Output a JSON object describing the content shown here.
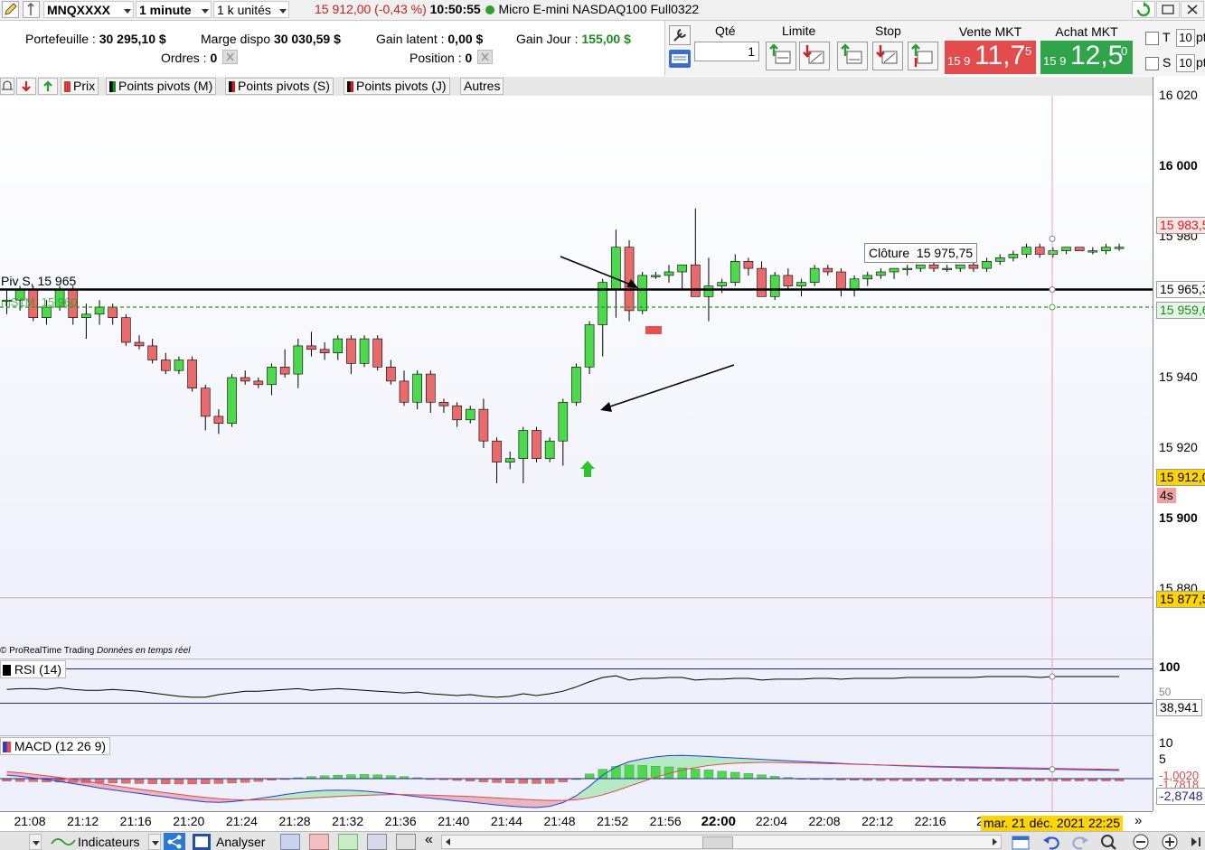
{
  "header": {
    "symbol": "MNQXXXX",
    "timeframe": "1 minute",
    "units": "1 k unités",
    "price_change": "15 912,00 (-0,43 %)",
    "time": "10:50:55",
    "instrument": "Micro E-mini NASDAQ100 Full0322",
    "status_color": "#28a428"
  },
  "account": {
    "portfolio_label": "Portefeuille :",
    "portfolio_value": "30 295,10 $",
    "margin_label": "Marge dispo",
    "margin_value": "30 030,59 $",
    "latent_label": "Gain latent :",
    "latent_value": "0,00 $",
    "day_gain_label": "Gain Jour :",
    "day_gain_value": "155,00 $",
    "orders_label": "Ordres :",
    "orders_value": "0",
    "position_label": "Position :",
    "position_value": "0"
  },
  "order_panel": {
    "qty_label": "Qté",
    "qty_value": "1",
    "limit_label": "Limite",
    "stop_label": "Stop",
    "sell_label": "Vente MKT",
    "sell_small": "15 9",
    "sell_big": "11,7",
    "sell_sup": "5",
    "buy_label": "Achat MKT",
    "buy_small": "15 9",
    "buy_big": "12,5",
    "buy_sup": "0",
    "t_label": "T",
    "s_label": "S",
    "t_value": "10",
    "s_value": "10",
    "t_unit": "pt",
    "s_unit": "pt",
    "sell_color": "#e24c4c",
    "buy_color": "#30a44a"
  },
  "chart_toolbar": {
    "items": [
      "Prix",
      "Points pivots (M)",
      "Points pivots (S)",
      "Points pivots (J)",
      "Autres"
    ]
  },
  "chart_labels": {
    "pivot_label": "Piv S, 15 965",
    "pivot_sub_label": "mS1M, 15 960",
    "tooltip_label": "Clôture",
    "tooltip_value": "15 975,75",
    "credit": "© ProRealTime Trading",
    "credit_realtime": "Données en temps réel",
    "rsi_label": "RSI (14)",
    "macd_label": "MACD (12 26 9)"
  },
  "price_axis": {
    "labels": [
      {
        "value": 16020,
        "text": "16 020",
        "bold": false
      },
      {
        "value": 16000,
        "text": "16 000",
        "bold": true
      },
      {
        "value": 15980,
        "text": "15 980",
        "bold": false
      },
      {
        "value": 15940,
        "text": "15 940",
        "bold": false
      },
      {
        "value": 15920,
        "text": "15 920",
        "bold": false
      },
      {
        "value": 15900,
        "text": "15 900",
        "bold": true
      },
      {
        "value": 15880,
        "text": "15 880",
        "bold": false
      }
    ],
    "tags": [
      {
        "value": 15983.5,
        "text": "15 983,5",
        "bg": "#ffe4e4",
        "fg": "#d02020"
      },
      {
        "value": 15965.3,
        "text": "15 965,3",
        "bg": "#ffffff",
        "fg": "#000000"
      },
      {
        "value": 15959.6,
        "text": "15 959,6",
        "bg": "#e6f6e6",
        "fg": "#1a8a1a"
      },
      {
        "value": 15912.0,
        "text": "15 912,0",
        "bg": "#ffd400",
        "fg": "#000000"
      },
      {
        "value": 15877.5,
        "text": "15 877,5",
        "bg": "#ffd400",
        "fg": "#000000"
      }
    ],
    "countdown": "4s",
    "rsi_top": "100",
    "rsi_50": "50",
    "rsi_value": "38,941",
    "macd_10": "10",
    "macd_5": "5",
    "macd_v1": "-1,0020",
    "macd_v2": "-1,7818",
    "macd_v3": "-2,8748"
  },
  "time_axis": {
    "labels": [
      "21:08",
      "21:12",
      "21:16",
      "21:20",
      "21:24",
      "21:28",
      "21:32",
      "21:36",
      "21:40",
      "21:44",
      "21:48",
      "21:52",
      "21:56",
      "22:00",
      "22:04",
      "22:08",
      "22:12",
      "22:16",
      "22"
    ],
    "bold": "22:00",
    "cursor_date": "mar. 21 déc. 2021 22:25"
  },
  "bottom_bar": {
    "indicators_label": "Indicateurs",
    "analyze_label": "Analyser"
  },
  "chart_data": {
    "type": "candlestick",
    "ylim": [
      15870,
      16025
    ],
    "candles": [
      [
        15962,
        15965,
        15958,
        15962
      ],
      [
        15962,
        15966,
        15959,
        15965
      ],
      [
        15965,
        15966,
        15956,
        15957
      ],
      [
        15957,
        15962,
        15955,
        15960
      ],
      [
        15960,
        15966,
        15959,
        15965
      ],
      [
        15965,
        15966,
        15955,
        15957
      ],
      [
        15957,
        15961,
        15951,
        15958
      ],
      [
        15958,
        15962,
        15955,
        15960
      ],
      [
        15960,
        15961,
        15955,
        15957
      ],
      [
        15957,
        15958,
        15949,
        15950
      ],
      [
        15950,
        15952,
        15948,
        15949
      ],
      [
        15949,
        15951,
        15944,
        15945
      ],
      [
        15945,
        15947,
        15941,
        15942
      ],
      [
        15942,
        15946,
        15941,
        15945
      ],
      [
        15945,
        15946,
        15936,
        15937
      ],
      [
        15937,
        15938,
        15925,
        15929
      ],
      [
        15929,
        15931,
        15924,
        15927
      ],
      [
        15927,
        15941,
        15926,
        15940
      ],
      [
        15940,
        15942,
        15938,
        15939
      ],
      [
        15939,
        15940,
        15937,
        15938
      ],
      [
        15938,
        15944,
        15935,
        15943
      ],
      [
        15943,
        15948,
        15940,
        15941
      ],
      [
        15941,
        15951,
        15937,
        15949
      ],
      [
        15949,
        15953,
        15946,
        15948
      ],
      [
        15948,
        15950,
        15945,
        15947
      ],
      [
        15947,
        15952,
        15945,
        15951
      ],
      [
        15951,
        15952,
        15941,
        15944
      ],
      [
        15944,
        15952,
        15943,
        15951
      ],
      [
        15951,
        15952,
        15942,
        15943
      ],
      [
        15943,
        15945,
        15938,
        15939
      ],
      [
        15939,
        15942,
        15932,
        15933
      ],
      [
        15933,
        15942,
        15931,
        15941
      ],
      [
        15941,
        15942,
        15930,
        15933
      ],
      [
        15933,
        15934,
        15930,
        15932
      ],
      [
        15932,
        15933,
        15926,
        15928
      ],
      [
        15928,
        15932,
        15927,
        15931
      ],
      [
        15931,
        15934,
        15920,
        15922
      ],
      [
        15922,
        15923,
        15910,
        15916
      ],
      [
        15916,
        15919,
        15914,
        15917
      ],
      [
        15917,
        15926,
        15910,
        15925
      ],
      [
        15925,
        15926,
        15916,
        15917
      ],
      [
        15917,
        15923,
        15916,
        15922
      ],
      [
        15922,
        15934,
        15915,
        15933
      ],
      [
        15933,
        15944,
        15932,
        15943
      ],
      [
        15943,
        15956,
        15941,
        15955
      ],
      [
        15955,
        15968,
        15946,
        15967
      ],
      [
        15965,
        15982,
        15957,
        15977
      ],
      [
        15977,
        15979,
        15956,
        15959
      ],
      [
        15959,
        15970,
        15958,
        15969
      ],
      [
        15969,
        15970,
        15968,
        15969
      ],
      [
        15969,
        15972,
        15967,
        15970
      ],
      [
        15970,
        15972,
        15965,
        15972
      ],
      [
        15972,
        15988,
        15967,
        15963
      ],
      [
        15963,
        15974,
        15956,
        15966
      ],
      [
        15966,
        15968,
        15964,
        15967
      ],
      [
        15967,
        15975,
        15966,
        15973
      ],
      [
        15973,
        15974,
        15969,
        15971
      ],
      [
        15971,
        15973,
        15964,
        15963
      ],
      [
        15963,
        15970,
        15962,
        15969
      ],
      [
        15969,
        15971,
        15965,
        15966
      ],
      [
        15966,
        15968,
        15963,
        15967
      ],
      [
        15967,
        15972,
        15966,
        15971
      ],
      [
        15971,
        15972,
        15969,
        15970
      ],
      [
        15970,
        15971,
        15963,
        15965
      ],
      [
        15965,
        15969,
        15963,
        15968
      ],
      [
        15968,
        15970,
        15966,
        15969
      ],
      [
        15969,
        15971,
        15968,
        15970
      ],
      [
        15970,
        15971,
        15968,
        15971
      ],
      [
        15971,
        15972,
        15969,
        15971
      ],
      [
        15971,
        15972,
        15970,
        15972
      ],
      [
        15972,
        15973,
        15970,
        15971
      ],
      [
        15971,
        15972,
        15970,
        15971
      ],
      [
        15971,
        15972,
        15970,
        15972
      ],
      [
        15972,
        15973,
        15970,
        15971
      ],
      [
        15971,
        15974,
        15970,
        15973
      ],
      [
        15973,
        15975,
        15972,
        15974
      ],
      [
        15974,
        15976,
        15973,
        15975
      ],
      [
        15975,
        15978,
        15974,
        15977
      ],
      [
        15977,
        15978,
        15974,
        15975
      ],
      [
        15975,
        15977,
        15974,
        15976
      ],
      [
        15976,
        15977,
        15975,
        15977
      ],
      [
        15977,
        15977,
        15976,
        15976
      ],
      [
        15976,
        15977,
        15975,
        15976
      ],
      [
        15976,
        15978,
        15975,
        15977
      ],
      [
        15977,
        15978,
        15976,
        15977
      ]
    ],
    "pivot_s": 15965,
    "pivot_ms1m": 15960,
    "rsi": [
      46,
      47,
      47,
      46,
      48,
      46,
      45,
      45,
      46,
      45,
      44,
      42,
      40,
      38,
      37,
      37,
      40,
      42,
      44,
      44,
      45,
      46,
      47,
      45,
      46,
      47,
      46,
      45,
      44,
      43,
      42,
      43,
      41,
      40,
      39,
      40,
      38,
      37,
      38,
      41,
      39,
      41,
      44,
      49,
      55,
      60,
      62,
      57,
      59,
      59,
      60,
      60,
      57,
      58,
      58,
      59,
      59,
      57,
      58,
      58,
      58,
      59,
      59,
      58,
      59,
      59,
      59,
      59,
      60,
      60,
      60,
      60,
      60,
      60,
      61,
      61,
      61,
      61,
      60,
      61,
      61,
      61,
      61,
      61,
      61
    ],
    "rsi_levels": [
      70,
      30
    ],
    "macd_hist": [
      -1.1,
      -1.2,
      -1.3,
      -1.4,
      -1.5,
      -1.6,
      -1.7,
      -1.8,
      -1.9,
      -2.0,
      -2.1,
      -2.2,
      -2.2,
      -2.3,
      -2.3,
      -2.2,
      -2.1,
      -1.9,
      -1.6,
      -1.2,
      -0.7,
      -0.2,
      0.4,
      0.9,
      1.2,
      1.5,
      1.7,
      1.8,
      1.6,
      1.3,
      0.9,
      0.4,
      -0.1,
      -0.5,
      -0.8,
      -1.1,
      -1.4,
      -1.7,
      -1.9,
      -2.0,
      -2.1,
      -2.0,
      -1.4,
      -0.2,
      2.0,
      4.0,
      5.2,
      5.8,
      5.6,
      5.3,
      5.0,
      4.6,
      4.2,
      3.7,
      3.2,
      2.7,
      2.2,
      1.6,
      1.0,
      0.5,
      0.1,
      -0.2,
      -0.4,
      -0.6,
      -0.7,
      -0.8,
      -0.9,
      -0.9,
      -1.0,
      -1.0,
      -1.0,
      -1.0,
      -1.0,
      -1.0,
      -1.0,
      -1.0,
      -1.0,
      -1.0,
      -1.0,
      -1.0,
      -1.0,
      -1.0,
      -1.0,
      -1.0,
      -1.0
    ],
    "macd_line": [
      1.5,
      1.0,
      0.3,
      -0.4,
      -1.2,
      -2.1,
      -3.0,
      -4.0,
      -4.8,
      -5.6,
      -6.3,
      -7.1,
      -7.8,
      -8.6,
      -9.3,
      -9.9,
      -10.1,
      -9.8,
      -9.2,
      -8.5,
      -7.7,
      -6.8,
      -6.0,
      -5.4,
      -5.0,
      -4.9,
      -5.0,
      -5.3,
      -5.8,
      -6.4,
      -7.0,
      -7.7,
      -8.3,
      -8.9,
      -9.5,
      -10.0,
      -10.6,
      -11.2,
      -11.7,
      -12.1,
      -12.3,
      -11.8,
      -10.2,
      -7.3,
      -3.2,
      1.5,
      5.0,
      7.2,
      8.4,
      9.3,
      9.8,
      9.9,
      9.7,
      9.4,
      9.1,
      8.8,
      8.5,
      8.2,
      7.9,
      7.6,
      7.3,
      7.0,
      6.8,
      6.5,
      6.2,
      6.0,
      5.8,
      5.6,
      5.4,
      5.2,
      5.0,
      4.9,
      4.7,
      4.6,
      4.5,
      4.4,
      4.3,
      4.2,
      4.1,
      4.0,
      3.9,
      3.8,
      3.7,
      3.6,
      3.5
    ],
    "signal_line": [
      3.0,
      2.5,
      1.9,
      1.2,
      0.5,
      -0.3,
      -1.1,
      -2.0,
      -2.9,
      -3.7,
      -4.5,
      -5.2,
      -6.0,
      -6.7,
      -7.4,
      -8.0,
      -8.5,
      -8.9,
      -9.1,
      -9.1,
      -9.0,
      -8.8,
      -8.5,
      -8.2,
      -7.9,
      -7.6,
      -7.3,
      -7.1,
      -6.9,
      -6.8,
      -6.8,
      -6.9,
      -7.0,
      -7.2,
      -7.4,
      -7.6,
      -7.9,
      -8.2,
      -8.5,
      -8.8,
      -9.1,
      -9.3,
      -9.3,
      -9.0,
      -8.2,
      -6.9,
      -5.2,
      -3.2,
      -1.3,
      0.6,
      2.2,
      3.6,
      4.7,
      5.6,
      6.2,
      6.6,
      6.8,
      6.9,
      6.9,
      6.8,
      6.7,
      6.6,
      6.4,
      6.3,
      6.1,
      6.0,
      5.8,
      5.7,
      5.6,
      5.4,
      5.3,
      5.2,
      5.1,
      5.0,
      4.9,
      4.8,
      4.7,
      4.6,
      4.5,
      4.4,
      4.3,
      4.2,
      4.1,
      4.0,
      3.9
    ]
  }
}
